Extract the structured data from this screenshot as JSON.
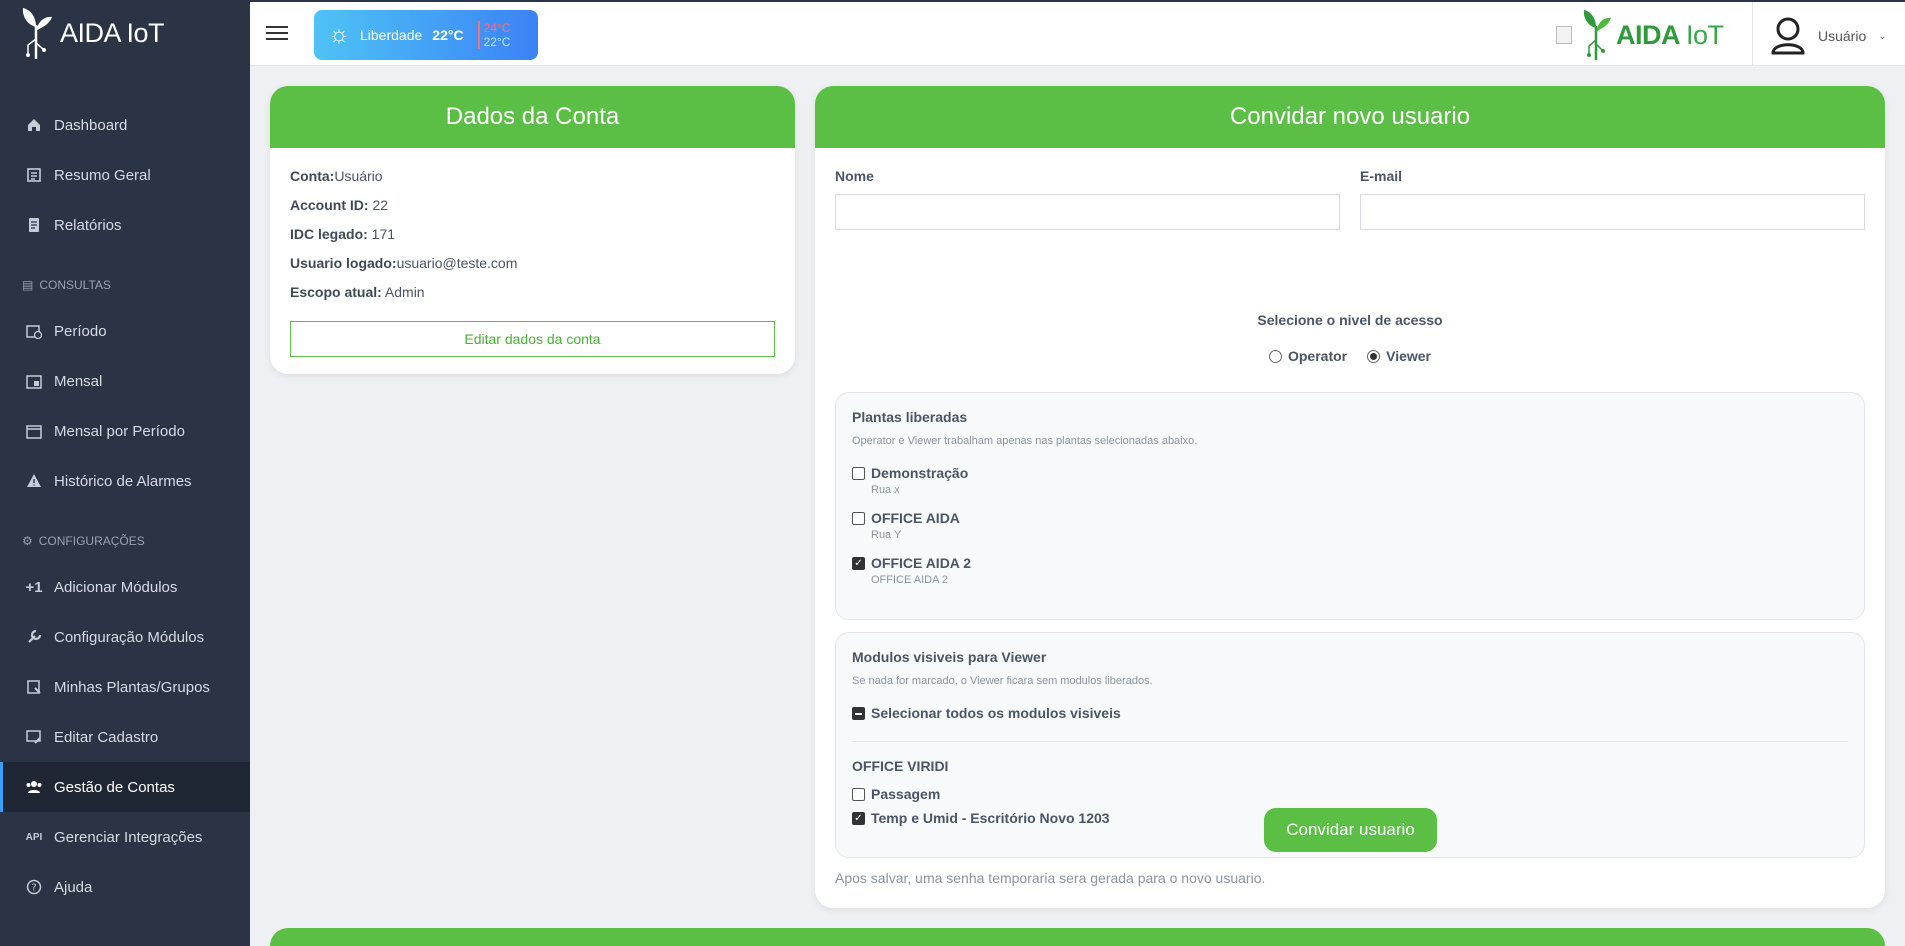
{
  "brand": {
    "name": "AIDA IoT"
  },
  "sidebar": {
    "items_main": [
      {
        "label": "Dashboard",
        "icon": "home-icon"
      },
      {
        "label": "Resumo Geral",
        "icon": "summary-icon"
      },
      {
        "label": "Relatórios",
        "icon": "report-icon"
      }
    ],
    "section_consultas": "CONSULTAS",
    "items_consultas": [
      {
        "label": "Período",
        "icon": "calendar-clock-icon"
      },
      {
        "label": "Mensal",
        "icon": "calendar-icon"
      },
      {
        "label": "Mensal por Período",
        "icon": "calendar-range-icon"
      },
      {
        "label": "Histórico de Alarmes",
        "icon": "alert-icon"
      }
    ],
    "section_config": "CONFIGURAÇÕES",
    "items_config": [
      {
        "label": "Adicionar Módulos",
        "icon": "plus-icon"
      },
      {
        "label": "Configuração Módulos",
        "icon": "wrench-icon"
      },
      {
        "label": "Minhas Plantas/Grupos",
        "icon": "plants-icon"
      },
      {
        "label": "Editar Cadastro",
        "icon": "edit-icon"
      },
      {
        "label": "Gestão de Contas",
        "icon": "users-icon"
      },
      {
        "label": "Gerenciar Integrações",
        "icon": "api-icon"
      },
      {
        "label": "Ajuda",
        "icon": "help-icon"
      }
    ],
    "active": "Gestão de Contas"
  },
  "topbar": {
    "weather": {
      "city": "Liberdade",
      "temp": "22°C",
      "max": "24°C",
      "min": "22°C"
    },
    "logo_text": "AIDA",
    "logo_suffix": "IoT",
    "user_name": "Usuário"
  },
  "account": {
    "title": "Dados da Conta",
    "conta_label": "Conta:",
    "conta_value": "Usuário",
    "account_id_label": "Account ID:",
    "account_id_value": " 22",
    "idc_label": "IDC legado:",
    "idc_value": " 171",
    "user_label": "Usuario logado:",
    "user_value": "usuario@teste.com",
    "scope_label": "Escopo atual:",
    "scope_value": " Admin",
    "edit_button": "Editar dados da conta"
  },
  "invite": {
    "title": "Convidar novo usuario",
    "name_label": "Nome",
    "name_value": "",
    "email_label": "E-mail",
    "email_value": "",
    "access_title": "Selecione o nivel de acesso",
    "access_options": [
      {
        "label": "Operator",
        "selected": false
      },
      {
        "label": "Viewer",
        "selected": true
      }
    ],
    "plants": {
      "title": "Plantas liberadas",
      "subtitle": "Operator e Viewer trabalham apenas nas plantas selecionadas abaixo.",
      "items": [
        {
          "name": "Demonstração",
          "address": "Rua x",
          "checked": false
        },
        {
          "name": "OFFICE AIDA",
          "address": "Rua Y",
          "checked": false
        },
        {
          "name": "OFFICE AIDA 2",
          "address": "OFFICE AIDA 2",
          "checked": true
        }
      ]
    },
    "modules": {
      "title": "Modulos visiveis para Viewer",
      "subtitle": "Se nada for marcado, o Viewer ficara sem modulos liberados.",
      "select_all": "Selecionar todos os modulos visiveis",
      "group": "OFFICE VIRIDI",
      "items": [
        {
          "name": "Passagem",
          "checked": false
        },
        {
          "name": "Temp e Umid - Escritório Novo 1203",
          "checked": true
        }
      ]
    },
    "submit": "Convidar usuario",
    "note": "Apos salvar, uma senha temporaria sera gerada para o novo usuario."
  },
  "colors": {
    "accent": "#5cbf45",
    "sidebar": "#2a3444",
    "weather_from": "#4ec3f5",
    "weather_to": "#3b82f6"
  }
}
